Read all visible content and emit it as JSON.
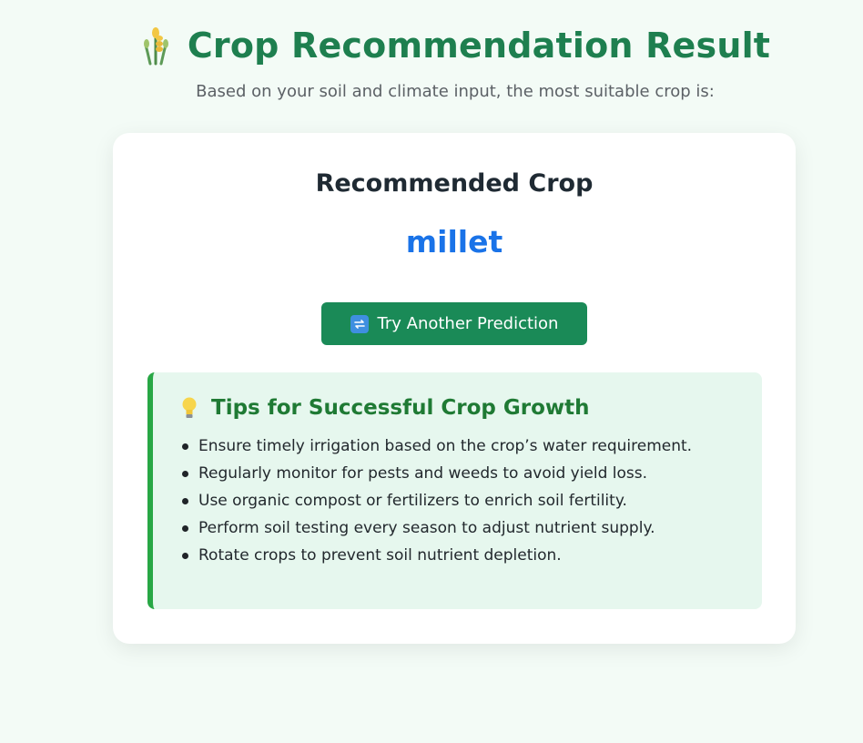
{
  "header": {
    "icon": "sheaf-of-rice-icon",
    "title": "Crop Recommendation Result",
    "subtitle": "Based on your soil and climate input, the most suitable crop is:"
  },
  "result": {
    "heading": "Recommended Crop",
    "crop": "millet",
    "button_icon": "repeat-icon",
    "button_label": "Try Another Prediction"
  },
  "tips": {
    "icon": "light-bulb-icon",
    "title": "Tips for Successful Crop Growth",
    "items": [
      "Ensure timely irrigation based on the crop’s water requirement.",
      "Regularly monitor for pests and weeds to avoid yield loss.",
      "Use organic compost or fertilizers to enrich soil fertility.",
      "Perform soil testing every season to adjust nutrient supply.",
      "Rotate crops to prevent soil nutrient depletion."
    ]
  },
  "colors": {
    "title_green": "#1e7f4f",
    "crop_blue": "#1a73e8",
    "button_green": "#1a8a57",
    "tips_bg": "#e6f7ee",
    "tips_border": "#28a745"
  }
}
